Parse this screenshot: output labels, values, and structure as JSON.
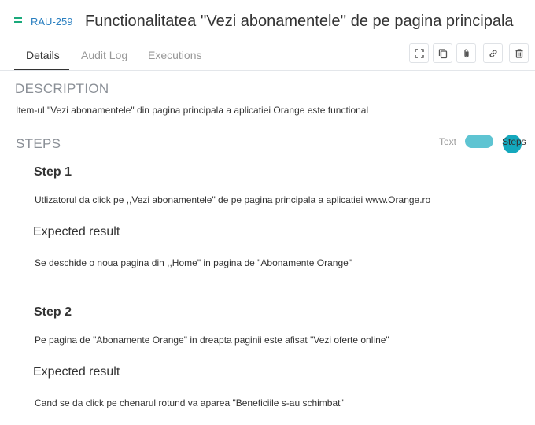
{
  "header": {
    "priority_icon": "equals-priority-icon",
    "issue_key": "RAU-259",
    "title": "Functionalitatea ''Vezi abonamentele'' de pe pagina principala"
  },
  "tabs": [
    {
      "label": "Details",
      "active": true
    },
    {
      "label": "Audit Log",
      "active": false
    },
    {
      "label": "Executions",
      "active": false
    }
  ],
  "toolbar": {
    "icons": [
      "expand-icon",
      "copy-icon",
      "attachment-icon",
      "link-icon",
      "trash-icon"
    ]
  },
  "description": {
    "heading": "DESCRIPTION",
    "text": "Item-ul \"Vezi abonamentele\" din pagina principala a aplicatiei Orange este functional"
  },
  "steps": {
    "heading": "STEPS",
    "toggle": {
      "left_label": "Text",
      "right_label": "Steps",
      "on": true,
      "accent": "#14a8bd"
    },
    "expected_heading": "Expected result",
    "items": [
      {
        "title": "Step 1",
        "action": "Utlizatorul da click pe ,,Vezi abonamentele\" de pe pagina principala a aplicatiei www.Orange.ro",
        "expected": "Se deschide o noua pagina din ,,Home\" in pagina de \"Abonamente Orange\""
      },
      {
        "title": "Step 2",
        "action": "Pe pagina de \"Abonamente Orange\" in dreapta paginii este afisat \"Vezi oferte online\"",
        "expected": "Cand se da click pe chenarul rotund va aparea \"Beneficiile s-au schimbat\""
      }
    ]
  }
}
